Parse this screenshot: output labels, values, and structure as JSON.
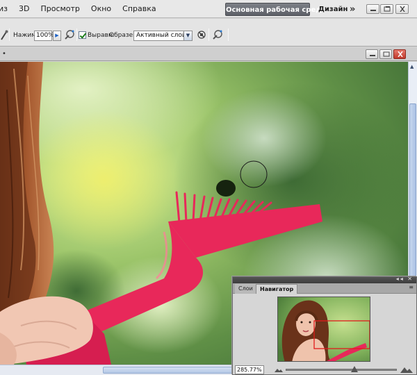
{
  "menu": {
    "items": [
      "из",
      "3D",
      "Просмотр",
      "Окно",
      "Справка"
    ]
  },
  "workspace": {
    "active_label": "Основная рабочая среда",
    "design_label": "Дизайн",
    "more_icon": "double-chevron-right-icon"
  },
  "options": {
    "pressure_label": "Нажим:",
    "pressure_value": "100%",
    "aligned_label": "Выравн.",
    "aligned_checked": true,
    "sample_label": "Образец:",
    "sample_value": "Активный слой"
  },
  "panel": {
    "tabs": [
      "Слои",
      "Навигатор"
    ],
    "active_tab": "Навигатор",
    "zoom_value": "285.77%"
  },
  "colors": {
    "workspace_active_bg": "#6a6d74",
    "comb_pink": "#e8285a",
    "navigator_view_box": "#e11b1b"
  }
}
